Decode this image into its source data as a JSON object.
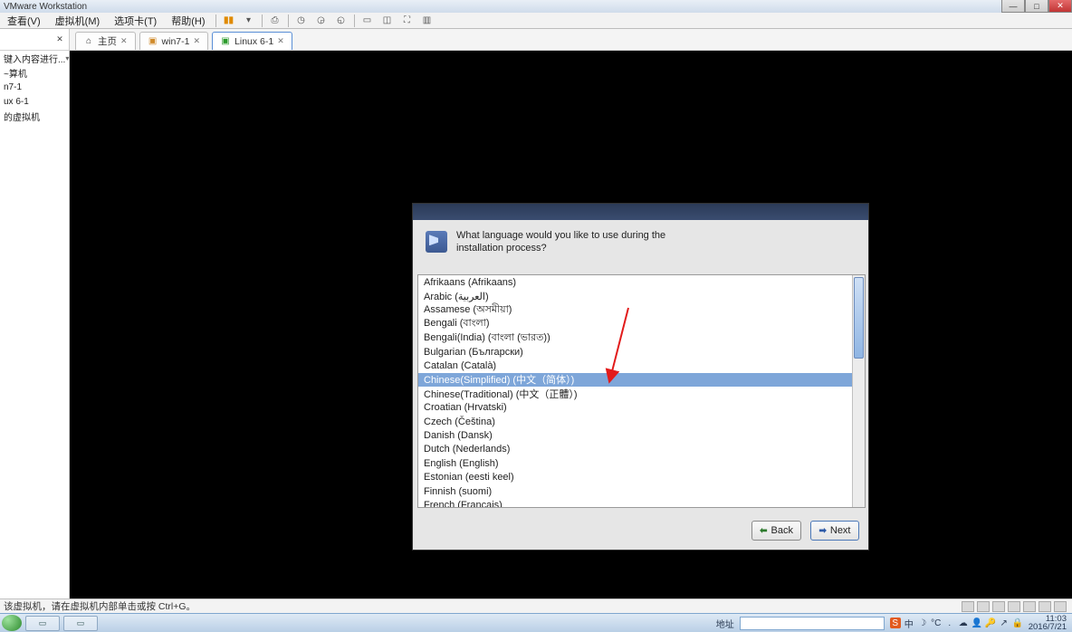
{
  "titlebar": {
    "title": "VMware Workstation"
  },
  "menubar": {
    "items": [
      "查看(V)",
      "虚拟机(M)",
      "选项卡(T)",
      "帮助(H)"
    ]
  },
  "sidebar": {
    "search": "键入内容进行...",
    "rows": [
      "~算机",
      "n7-1",
      "ux 6-1",
      "的虚拟机"
    ]
  },
  "tabs": [
    {
      "label": "主页"
    },
    {
      "label": "win7-1"
    },
    {
      "label": "Linux 6-1",
      "active": true
    }
  ],
  "installer": {
    "question_l1": "What language would you like to use during the",
    "question_l2": "installation process?",
    "languages": [
      "Afrikaans (Afrikaans)",
      "Arabic (العربية)",
      "Assamese (অসমীয়া)",
      "Bengali (বাংলা)",
      "Bengali(India) (বাংলা (ভারত))",
      "Bulgarian (Български)",
      "Catalan (Català)",
      "Chinese(Simplified) (中文（简体）)",
      "Chinese(Traditional) (中文（正體）)",
      "Croatian (Hrvatski)",
      "Czech (Čeština)",
      "Danish (Dansk)",
      "Dutch (Nederlands)",
      "English (English)",
      "Estonian (eesti keel)",
      "Finnish (suomi)",
      "French (Français)"
    ],
    "selected_index": 7,
    "back": "Back",
    "next": "Next"
  },
  "statusbar": {
    "text": "该虚拟机，请在虚拟机内部单击或按 Ctrl+G。"
  },
  "taskbar": {
    "addr_label": "地址",
    "clock_time": "11:03",
    "clock_date": "2016/7/21",
    "tray_glyphs": [
      "S",
      "中",
      "☽",
      "°C",
      ".",
      "☁",
      "👤",
      "🔑",
      "↗",
      "🔒"
    ]
  }
}
